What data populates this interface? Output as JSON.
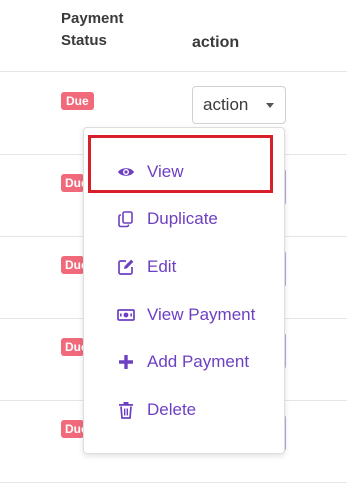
{
  "table": {
    "headers": {
      "payment_status_line1": "Payment",
      "payment_status_line2": "Status",
      "action": "action"
    },
    "rows": [
      {
        "status": "Due"
      },
      {
        "status": "Due"
      },
      {
        "status": "Due"
      },
      {
        "status": "Due"
      },
      {
        "status": "Due"
      }
    ]
  },
  "action_dropdown": {
    "label": "action",
    "menu_items": [
      {
        "label": "View",
        "icon": "eye-icon"
      },
      {
        "label": "Duplicate",
        "icon": "copy-icon"
      },
      {
        "label": "Edit",
        "icon": "edit-icon"
      },
      {
        "label": "View Payment",
        "icon": "money-icon"
      },
      {
        "label": "Add Payment",
        "icon": "plus-icon"
      },
      {
        "label": "Delete",
        "icon": "trash-icon"
      }
    ],
    "highlighted_item": "View"
  },
  "colors": {
    "accent": "#6d40c2",
    "badge_due": "#f06a7b",
    "highlight": "#d8202a"
  }
}
